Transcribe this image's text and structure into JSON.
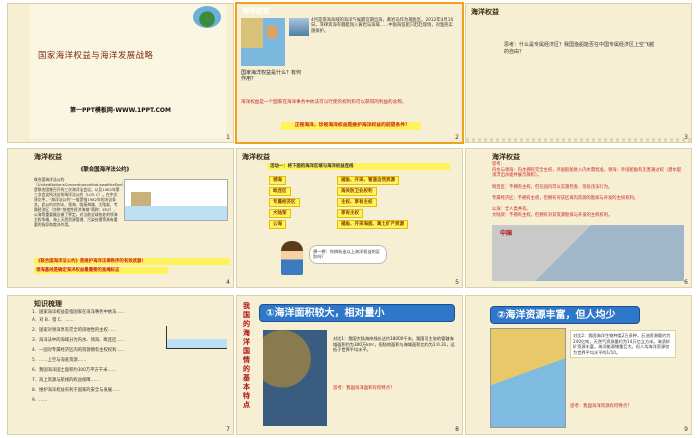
{
  "slides": [
    {
      "num": "1",
      "title": "国家海洋权益与海洋发展战略",
      "footer": "第一PPT模板网-WWW.1PPT.COM"
    },
    {
      "num": "2",
      "header": "海洋权益",
      "question": "国家海洋权益是什么？有何作用？",
      "para": "4月是南海海域的海洋气候最宜期出海，黄岩岛作为捕鱼区。2012年4月10日，菲律宾海军舰艇闯入黄岩岛海域……中国海监船只赶赴现场，对渔民实施保护。",
      "red_line": "海洋权益是一个国家在海洋事务中依法可以行使的权利和可以获得的利益的总称。",
      "banner": "正视海洋，珍视海洋权益是维护海洋权益的前提条件!"
    },
    {
      "num": "3",
      "header": "海洋权益",
      "text": "思考：什么是专属经济区？我国渔船能否在中国专属经济区上空飞越的自由？"
    },
    {
      "num": "4",
      "header": "海洋权益",
      "title": "《联合国海洋法公约》",
      "body": "联合国海洋法公约（UnitedNationsConventionontheLawoftheSea）是联合国曾召开的三次海洋法会议，以及1982年第三次会议所决议的海洋法公约（LOS C）。在中文译文中，“海洋法公约”一般是指1982年的决议条文。此公约对内水、领海、临接海域、大陆架、专属经济区（亦称“排他性经济海域”简称：EEZ）、公海等重要概念做了界定。对当前全球各处的领海主权争端、海上天然资源管理、污染处理等具有重要的指导和裁决作用。",
      "highlight1": "《联合国海洋法公约》是维护海洋法律秩序的有效武器!",
      "highlight2": "领海基线是确定海洋权益最重要的准绳标志"
    },
    {
      "num": "5",
      "header": "海洋权益",
      "table_title": "活动一：将下面的海洋区域与海洋权益连线",
      "left": [
        "领海",
        "毗连区",
        "专属经济区",
        "大陆架",
        "公海"
      ],
      "right": [
        "捕鱼、开采、管道自然资源",
        "海关防卫业权利",
        "主权、享有主权",
        "享有主权",
        "捕鱼、开采海底、离土矿产资源"
      ],
      "bubble": "想一想：你辨析出以上海洋权益的区别吗？"
    },
    {
      "num": "6",
      "header": "海洋权益",
      "lines": [
        "思考：",
        "内水与领海：内水拥有完全主权，外国船舶进入内水需批准。领海：外国船舶有无害通过权（潜水艇须浮出水面并展示旗帜）。",
        "毗连区：不拥有主权，但在国内可以实施检查、惩处违法行为。",
        "专属经济区：不拥有主权，但拥有对该区域内资源的勘探与开发的主权权利。",
        "公海：全人类共有。",
        "大陆架：不拥有主权，但拥有对其资源勘探与开发的主权权利。"
      ],
      "map_label": "中国"
    },
    {
      "num": "7",
      "header": "知识梳理",
      "lines": [
        "1．国家海洋权益是指国家在海洋事务中依法……",
        "A．对  B．错  C．……",
        "2．国家对领海享有完全的排他性的主权……",
        "3．海洋法中的海域分为内水、领海、毗连区……",
        "4．一国对专属经济区内的资源拥有主权权利……",
        "5．……上空与海底资源……",
        "6．我国海洋国土面积约300万平方千米……",
        "7．海上资源与航线的权益保障……",
        "8．维护海洋权益有利于国家的安全与发展……",
        "9．……"
      ]
    },
    {
      "num": "8",
      "side": "我国的海洋国情的基本特点",
      "banner": "①海洋面积较大，相对量小",
      "text": "对比1：我国大陆海岸线长达约18000千米，我国可主张的管辖海域面积约为300万km²，但陆地面积与海域面积比约为1:0.31，远低于世界平均水平。",
      "question": "思考：我国海洋面积有何特点？"
    },
    {
      "num": "9",
      "banner": "②海洋资源丰富，但人均少",
      "text": "对比2：我国海洋生物种类2万多种，石油资源量约为240亿吨，天然气资源量约为14万亿立方米。海滨砂矿资源丰富，海洋能源储量巨大。但人均海洋资源仅为世界平均水平的1/10。",
      "question": "思考：我国海洋资源有何特点？"
    }
  ]
}
